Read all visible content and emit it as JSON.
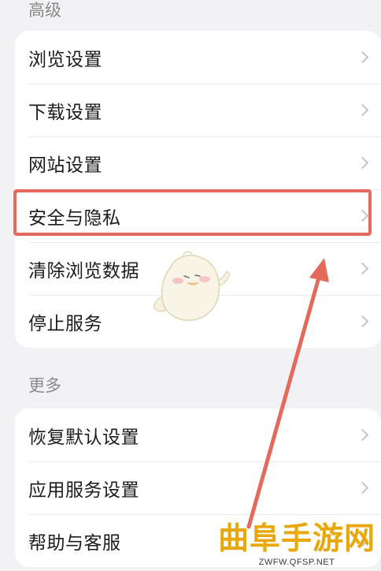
{
  "sections": {
    "advanced": {
      "header": "高级",
      "items": [
        {
          "label": "浏览设置"
        },
        {
          "label": "下载设置"
        },
        {
          "label": "网站设置"
        },
        {
          "label": "安全与隐私"
        },
        {
          "label": "清除浏览数据"
        },
        {
          "label": "停止服务"
        }
      ]
    },
    "more": {
      "header": "更多",
      "items": [
        {
          "label": "恢复默认设置"
        },
        {
          "label": "应用服务设置"
        },
        {
          "label": "帮助与客服"
        }
      ]
    }
  },
  "annotation": {
    "highlighted_item": "安全与隐私",
    "color": "#e36a5c"
  },
  "watermark": {
    "title": "曲阜手游网",
    "url": "ZWFW.QFSP.NET",
    "color": "#e8a80c"
  },
  "colors": {
    "background": "#f2f2f6",
    "card": "#ffffff",
    "header_text": "#8a8a8e",
    "item_text": "#1b1b1d",
    "chevron": "#c4c4c8"
  }
}
